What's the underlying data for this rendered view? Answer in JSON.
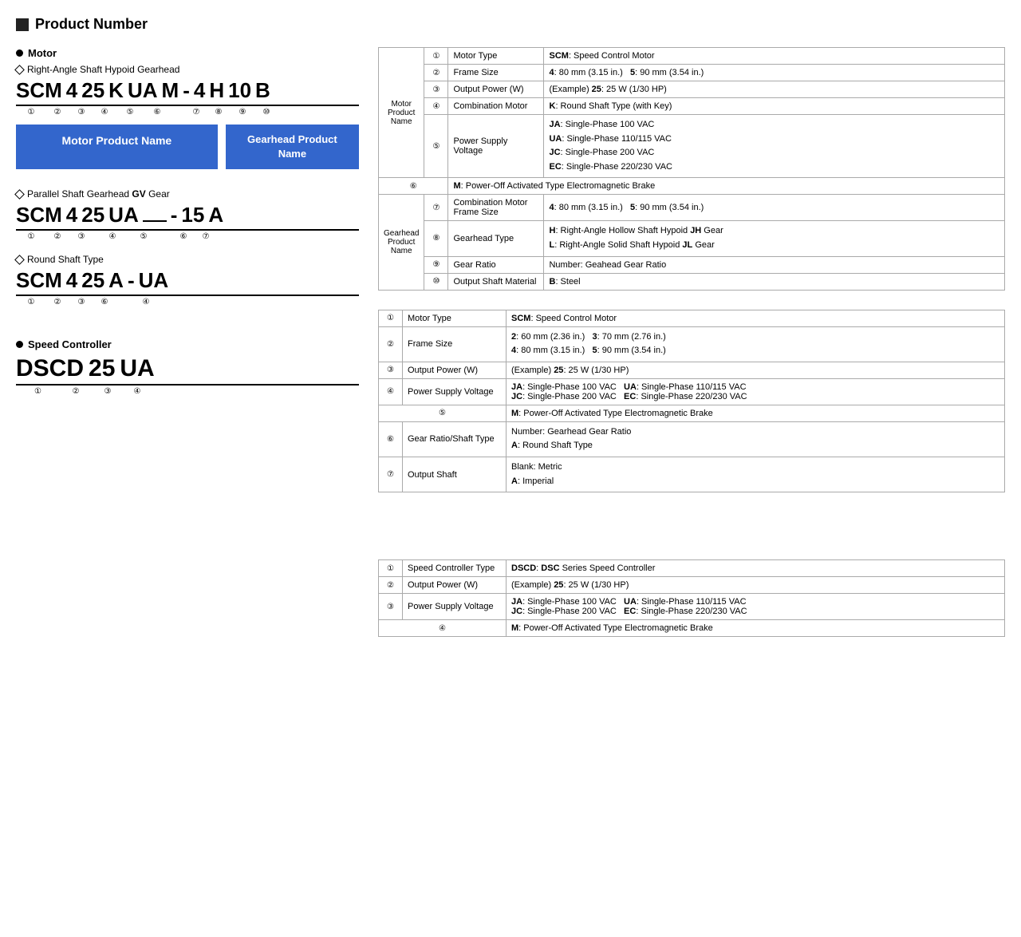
{
  "mainTitle": "Product Number",
  "sections": {
    "motor": {
      "label": "Motor",
      "subsections": [
        {
          "type": "diamond",
          "label": "Right-Angle Shaft Hypoid Gearhead",
          "code": [
            "SCM",
            "4",
            "25",
            "K",
            "UA",
            "M",
            "-",
            "4",
            "H",
            "10",
            "B"
          ],
          "circles": [
            "①",
            "②",
            "③",
            "④",
            "⑤",
            "⑥",
            "",
            "⑦",
            "⑧",
            "⑨",
            "⑩"
          ],
          "boxes": [
            "Motor Product Name",
            "Gearhead Product Name"
          ]
        },
        {
          "type": "diamond",
          "label": "Parallel Shaft Gearhead GV Gear",
          "code": [
            "SCM",
            "4",
            "25",
            "UA",
            "",
            "-",
            "15",
            "A"
          ],
          "circles": [
            "①",
            "②",
            "③",
            "④",
            "⑤",
            "",
            "⑥",
            "⑦"
          ]
        },
        {
          "type": "diamond",
          "label": "Round Shaft Type",
          "code": [
            "SCM",
            "4",
            "25",
            "A",
            "-",
            "UA"
          ],
          "circles": [
            "①",
            "②",
            "③",
            "⑥",
            "",
            "④"
          ]
        }
      ],
      "table1": {
        "rows": [
          {
            "num": "①",
            "label": "Motor Type",
            "desc": "<b>SCM</b>: Speed Control Motor",
            "rowspan": null
          },
          {
            "num": "②",
            "label": "Frame Size",
            "desc": "<b>4</b>: 80 mm (3.15 in.)   <b>5</b>: 90 mm (3.54 in.)",
            "rowspan": null
          },
          {
            "num": "③",
            "label": "Output Power (W)",
            "desc": "(Example) <b>25</b>: 25 W (1/30 HP)",
            "rowspan": null
          },
          {
            "num": "④",
            "label": "Combination Motor",
            "desc": "<b>K</b>: Round Shaft Type (with Key)",
            "rowspan": null
          },
          {
            "num": "⑤",
            "label": "Power Supply Voltage",
            "desc": "<b>JA</b>: Single-Phase 100 VAC<br><b>UA</b>: Single-Phase 110/115 VAC<br><b>JC</b>: Single-Phase 200 VAC<br><b>EC</b>: Single-Phase 220/230 VAC",
            "rowspan": null
          },
          {
            "num": "⑥",
            "label": "",
            "desc": "<b>M</b>: Power-Off Activated Type Electromagnetic Brake",
            "colspan": true
          },
          {
            "num": "⑦",
            "label": "Combination Motor Frame Size",
            "desc": "<b>4</b>: 80 mm (3.15 in.)   <b>5</b>: 90 mm (3.54 in.)",
            "rowspan": null
          },
          {
            "num": "⑧",
            "label": "Gearhead Type",
            "desc": "<b>H</b>: Right-Angle Hollow Shaft Hypoid <b>JH</b> Gear<br><b>L</b>: Right-Angle Solid Shaft Hypoid <b>JL</b> Gear",
            "rowspan": null
          },
          {
            "num": "⑨",
            "label": "Gear Ratio",
            "desc": "Number: Geahead Gear Ratio",
            "rowspan": null
          },
          {
            "num": "⑩",
            "label": "Output Shaft Material",
            "desc": "<b>B</b>: Steel",
            "rowspan": null
          }
        ],
        "motorProductNameLabel": "Motor Product Name",
        "gearheadProductNameLabel": "Gearhead Product Name"
      },
      "table2": {
        "rows": [
          {
            "num": "①",
            "label": "Motor Type",
            "desc": "<b>SCM</b>: Speed Control Motor"
          },
          {
            "num": "②",
            "label": "Frame Size",
            "desc": "<b>2</b>: 60 mm (2.36 in.)   <b>3</b>: 70 mm (2.76 in.)<br><b>4</b>: 80 mm (3.15 in.)   <b>5</b>: 90 mm (3.54 in.)"
          },
          {
            "num": "③",
            "label": "Output Power (W)",
            "desc": "(Example) <b>25</b>: 25 W (1/30 HP)"
          },
          {
            "num": "④",
            "label": "Power Supply Voltage",
            "desc": "<b>JA</b>: Single-Phase 100 VAC   <b>UA</b>: Single-Phase 110/115 VAC<br><b>JC</b>: Single-Phase 200 VAC   <b>EC</b>: Single-Phase 220/230 VAC"
          },
          {
            "num": "⑤",
            "label": "",
            "desc": "<b>M</b>: Power-Off Activated Type Electromagnetic Brake",
            "colspan": true
          },
          {
            "num": "⑥",
            "label": "Gear Ratio/Shaft Type",
            "desc": "Number: Gearhead Gear Ratio<br><b>A</b>: Round Shaft Type"
          },
          {
            "num": "⑦",
            "label": "Output Shaft",
            "desc": "Blank: Metric<br><b>A</b>: Imperial"
          }
        ]
      }
    },
    "speedController": {
      "label": "Speed Controller",
      "code": [
        "DSCD",
        "25",
        "UA"
      ],
      "circles": [
        "①",
        "②",
        "③",
        "④"
      ],
      "table": {
        "rows": [
          {
            "num": "①",
            "label": "Speed Controller Type",
            "desc": "<b>DSCD</b>: <b>DSC</b> Series Speed Controller"
          },
          {
            "num": "②",
            "label": "Output Power (W)",
            "desc": "(Example) <b>25</b>: 25 W (1/30 HP)"
          },
          {
            "num": "③",
            "label": "Power Supply Voltage",
            "desc": "<b>JA</b>: Single-Phase 100 VAC   <b>UA</b>: Single-Phase 110/115 VAC<br><b>JC</b>: Single-Phase 200 VAC   <b>EC</b>: Single-Phase 220/230 VAC"
          },
          {
            "num": "④",
            "label": "",
            "desc": "<b>M</b>: Power-Off Activated Type Electromagnetic Brake",
            "colspan": true
          }
        ]
      }
    }
  }
}
